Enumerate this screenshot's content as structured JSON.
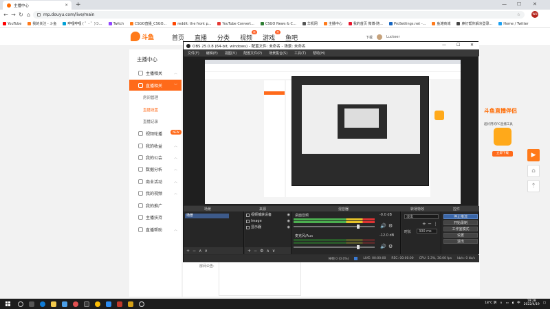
{
  "browser": {
    "tab_title": "主播中心",
    "url": "mp.douyu.com/live/main",
    "profile_initials": "WH",
    "bookmarks": [
      {
        "label": "YouTube",
        "color": "#ff0000"
      },
      {
        "label": "我的关注 - 斗鱼",
        "color": "#ff7a1a"
      },
      {
        "label": "哔哩哔哩 ( ゜- ゜)つ...",
        "color": "#00a1d6"
      },
      {
        "label": "Twitch",
        "color": "#9146ff"
      },
      {
        "label": "CSGO直播_CSGO...",
        "color": "#ff7a1a"
      },
      {
        "label": "reddit: the front p...",
        "color": "#ff4500"
      },
      {
        "label": "YouTube Convert...",
        "color": "#e53935"
      },
      {
        "label": "CSGO News & C...",
        "color": "#2e7d32"
      },
      {
        "label": "华机网",
        "color": "#555555"
      },
      {
        "label": "主播中心",
        "color": "#ff7a1a"
      },
      {
        "label": "我的首页 微博-随...",
        "color": "#e6162d"
      },
      {
        "label": "ProSettings.net -...",
        "color": "#1565c0"
      },
      {
        "label": "鱼滩商城",
        "color": "#ff7a1a"
      },
      {
        "label": "鼻钉帮你解决登录...",
        "color": "#444444"
      },
      {
        "label": "Home / Twitter",
        "color": "#1da1f2"
      }
    ]
  },
  "site": {
    "logo_text": "斗鱼",
    "nav": [
      "首页",
      "直播",
      "分类",
      "视频",
      "游戏",
      "鱼吧"
    ],
    "video_badge": "新",
    "game_badge": "热",
    "user_links": [
      "下载",
      "Luckeer"
    ]
  },
  "sidebar": {
    "title": "主播中心",
    "items": [
      {
        "label": "主播相关",
        "state": "collapsed"
      },
      {
        "label": "直播相关",
        "state": "expanded"
      },
      {
        "label": "视频轮播",
        "state": "collapsed"
      },
      {
        "label": "我的收益",
        "state": "collapsed"
      },
      {
        "label": "我的公会",
        "state": "collapsed"
      },
      {
        "label": "数据分析",
        "state": "collapsed"
      },
      {
        "label": "商业活动",
        "state": "collapsed"
      },
      {
        "label": "我的视频",
        "state": "collapsed"
      },
      {
        "label": "我的推广",
        "state": "collapsed"
      },
      {
        "label": "主播扶持",
        "state": "collapsed"
      },
      {
        "label": "直播帮助",
        "state": "collapsed"
      }
    ],
    "subitems": [
      "房间管理",
      "直播设置",
      "直播记录"
    ],
    "active_sub": "直播设置",
    "badge": "NEW"
  },
  "promo": {
    "title": "斗鱼直播伴侣",
    "subtitle": "超好用的PC直播工具",
    "icon_label": "DOUYU",
    "button": "立即下载"
  },
  "notice": {
    "label": "房间公告:"
  },
  "obs": {
    "title": "OBS 25.0.8 (64-bit, windows) - 配置文件: 未命名 - 场景: 未命名",
    "menu": [
      "文件(F)",
      "编辑(E)",
      "视图(V)",
      "配置文件(P)",
      "场景集合(S)",
      "工具(T)",
      "帮助(H)"
    ],
    "docks": [
      "场景",
      "来源",
      "混音器",
      "转场特效",
      "控件"
    ],
    "scenes": [
      "场景"
    ],
    "sources": [
      "视频捕获设备",
      "Image",
      "显示器"
    ],
    "mixer": [
      {
        "name": "桌面音频",
        "db": "-0.0 dB"
      },
      {
        "name": "麦克风/Aux",
        "db": "-12.0 dB"
      }
    ],
    "transition": {
      "type": "淡出",
      "duration_label": "时长",
      "duration": "300 ms"
    },
    "controls": [
      "停止推流",
      "开始录制",
      "工作室模式",
      "设置",
      "退出"
    ],
    "status": {
      "live": "LIVE: 00:00:00",
      "rec": "REC: 00:00:00",
      "cpu": "CPU: 5.3%, 30.00 fps",
      "kbps": "kb/s: 0 kb/s",
      "dropped": "掉帧 0 (0.0%)"
    }
  },
  "taskbar": {
    "weather": "18°C 阴",
    "time": "19:28",
    "date": "2022/4/19",
    "lang": "中"
  }
}
